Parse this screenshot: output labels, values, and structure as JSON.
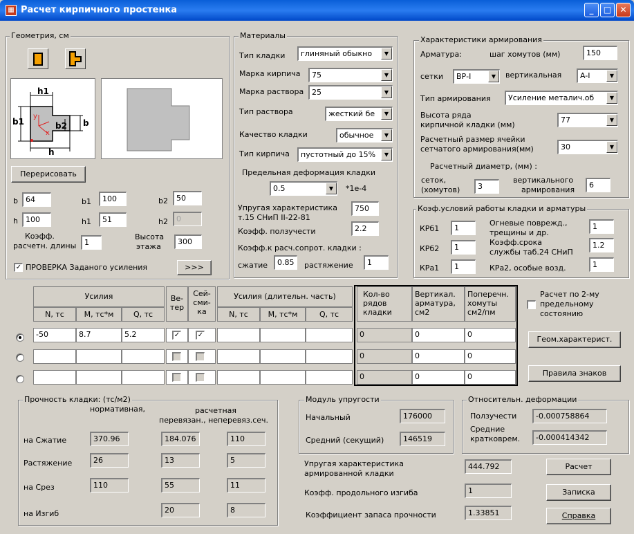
{
  "window": {
    "title": "Расчет кирпичного простенка"
  },
  "geometry": {
    "group_title": "Геометрия, см",
    "redraw_button": "Перерисовать",
    "diagram_labels": {
      "h1": "h1",
      "b1": "b1",
      "b2": "b2",
      "b": "b",
      "h": "h",
      "y": "y",
      "x": "x"
    },
    "fields": {
      "b_label": "b",
      "b_value": "64",
      "b1_label": "b1",
      "b1_value": "100",
      "b2_label": "b2",
      "b2_value": "50",
      "h_label": "h",
      "h_value": "100",
      "h1_label": "h1",
      "h1_value": "51",
      "h2_label": "h2",
      "h2_value": "0"
    },
    "calc_length_label_1": "Коэфф.",
    "calc_length_label_2": "расчетн. длины",
    "calc_length_value": "1",
    "floor_height_label_1": "Высота",
    "floor_height_label_2": "этажа",
    "floor_height_value": "300",
    "check_label": "ПРОВЕРКА Заданого усиления",
    "check_checked": true,
    "more_button": ">>>"
  },
  "materials": {
    "group_title": "Материалы",
    "masonry_type_label": "Тип кладки",
    "masonry_type_value": "глиняный обыкно",
    "brick_grade_label": "Марка кирпича",
    "brick_grade_value": "75",
    "mortar_grade_label": "Марка раствора",
    "mortar_grade_value": "25",
    "mortar_type_label": "Тип раствора",
    "mortar_type_value": "жесткий бе",
    "quality_label": "Качество кладки",
    "quality_value": "обычное",
    "brick_type_label": "Тип кирпича",
    "brick_type_value": "пустотный до 15%",
    "max_deform_label": "Предельная деформация кладки",
    "max_deform_value": "0.5",
    "max_deform_unit": "*1e-4",
    "elastic_label_1": "Упругая характеристика",
    "elastic_label_2": "т.15 СНиП II-22-81",
    "elastic_value": "750",
    "creep_label": "Коэфф. ползучести",
    "creep_value": "2.2",
    "resist_label": "Коэфф.к расч.сопрот. кладки :",
    "compress_label": "сжатие",
    "compress_value": "0.85",
    "tension_label": "растяжение",
    "tension_value": "1"
  },
  "reinforcement": {
    "group_title": "Характеристики армирования",
    "rebar_label": "Арматура:",
    "stirrup_step_label": "шаг хомутов (мм)",
    "stirrup_step_value": "150",
    "mesh_label": "сетки",
    "mesh_value": "ВР-I",
    "vertical_label": "вертикальная",
    "vertical_value": "A-I",
    "type_label": "Тип армирования",
    "type_value": "Усиление металич.об",
    "row_height_label_1": "Высота ряда",
    "row_height_label_2": "кирпичной кладки (мм)",
    "row_height_value": "77",
    "cell_size_label_1": "Расчетный размер ячейки",
    "cell_size_label_2": "сетчатого армирования(мм)",
    "cell_size_value": "30",
    "diameter_label": "Расчетный диаметр, (мм) :",
    "mesh_diam_label_1": "сеток,",
    "mesh_diam_label_2": "(хомутов)",
    "mesh_diam_value": "3",
    "vert_diam_label_1": "вертикального",
    "vert_diam_label_2": "армирования",
    "vert_diam_value": "6"
  },
  "conditions": {
    "group_title": "Коэф.условий работы кладки и арматуры",
    "kr61_label": "КРб1",
    "kr61_value": "1",
    "kr62_label": "КРб2",
    "kr62_value": "1",
    "kra1_label": "КРа1",
    "kra1_value": "1",
    "fire_label_1": "Огневые поврежд.,",
    "fire_label_2": "трещины и др.",
    "fire_value": "1",
    "service_label_1": "Коэфф.срока",
    "service_label_2": "службы таб.24 СНиП",
    "service_value": "1.2",
    "kra2_label": "КРа2, особые возд.",
    "kra2_value": "1"
  },
  "forces": {
    "header_forces": "Усилия",
    "header_wind_1": "Ве-",
    "header_wind_2": "тер",
    "header_seismic_1": "Сей-",
    "header_seismic_2": "сми-",
    "header_seismic_3": "ка",
    "header_long": "Усилия (длительн. часть)",
    "col_n": "N, тс",
    "col_m": "M, тс*м",
    "col_q": "Q, тс",
    "col_n2": "N, тс",
    "col_m2": "M, тс*м",
    "col_q2": "Q, тс",
    "header_rows_1": "Кол-во",
    "header_rows_2": "рядов",
    "header_rows_3": "кладки",
    "header_vert_1": "Вертикал.",
    "header_vert_2": "арматура,",
    "header_vert_3": "см2",
    "header_trans_1": "Поперечн.",
    "header_trans_2": "хомуты",
    "header_trans_3": "см2/пм",
    "rows": [
      {
        "n": "-50",
        "m": "8.7",
        "q": "5.2",
        "wind": true,
        "seismic": true,
        "rows": "0",
        "vert": "0",
        "trans": "0",
        "selected": true
      },
      {
        "n": "",
        "m": "",
        "q": "",
        "wind": false,
        "seismic": false,
        "rows": "0",
        "vert": "0",
        "trans": "0",
        "selected": false
      },
      {
        "n": "",
        "m": "",
        "q": "",
        "wind": false,
        "seismic": false,
        "rows": "0",
        "vert": "0",
        "trans": "0",
        "selected": false
      }
    ]
  },
  "side": {
    "second_limit_1": "Расчет по 2-му",
    "second_limit_2": "предельному",
    "second_limit_3": "состоянию",
    "geom_button": "Геом.характерист.",
    "signs_button": "Правила знаков"
  },
  "strength": {
    "group_title": "Прочность кладки:  (тс/м2)",
    "normative_label": "нормативная,",
    "calc_label_1": "расчетная",
    "calc_label_2": "перевязан., неперевяз.сеч.",
    "rows": [
      {
        "label": "на Сжатие",
        "norm": "370.96",
        "tied": "184.076",
        "untied": "110"
      },
      {
        "label": "Растяжение",
        "norm": "26",
        "tied": "13",
        "untied": "5"
      },
      {
        "label": "на Срез",
        "norm": "110",
        "tied": "55",
        "untied": "11"
      },
      {
        "label": "на Изгиб",
        "norm": "",
        "tied": "20",
        "untied": "8"
      }
    ]
  },
  "modulus": {
    "group_title": "Модуль упругости",
    "initial_label": "Начальный",
    "initial_value": "176000",
    "avg_label": "Средний (секущий)",
    "avg_value": "146519"
  },
  "deform": {
    "group_title": "Относительн. деформации",
    "creep_label": "Ползучести",
    "creep_value": "-0.000758864",
    "avg_label_1": "Средние",
    "avg_label_2": "кратковрем.",
    "avg_value": "-0.000414342"
  },
  "results": {
    "elastic_label_1": "Упругая характеристика",
    "elastic_label_2": "армированной кладки",
    "elastic_value": "444.792",
    "buckling_label": "Коэфф. продольного изгиба",
    "buckling_value": "1",
    "safety_label": "Коэффициент  запаса  прочности",
    "safety_value": "1.33851",
    "calc_button": "Расчет",
    "note_button": "Записка",
    "help_button": "Справка"
  }
}
